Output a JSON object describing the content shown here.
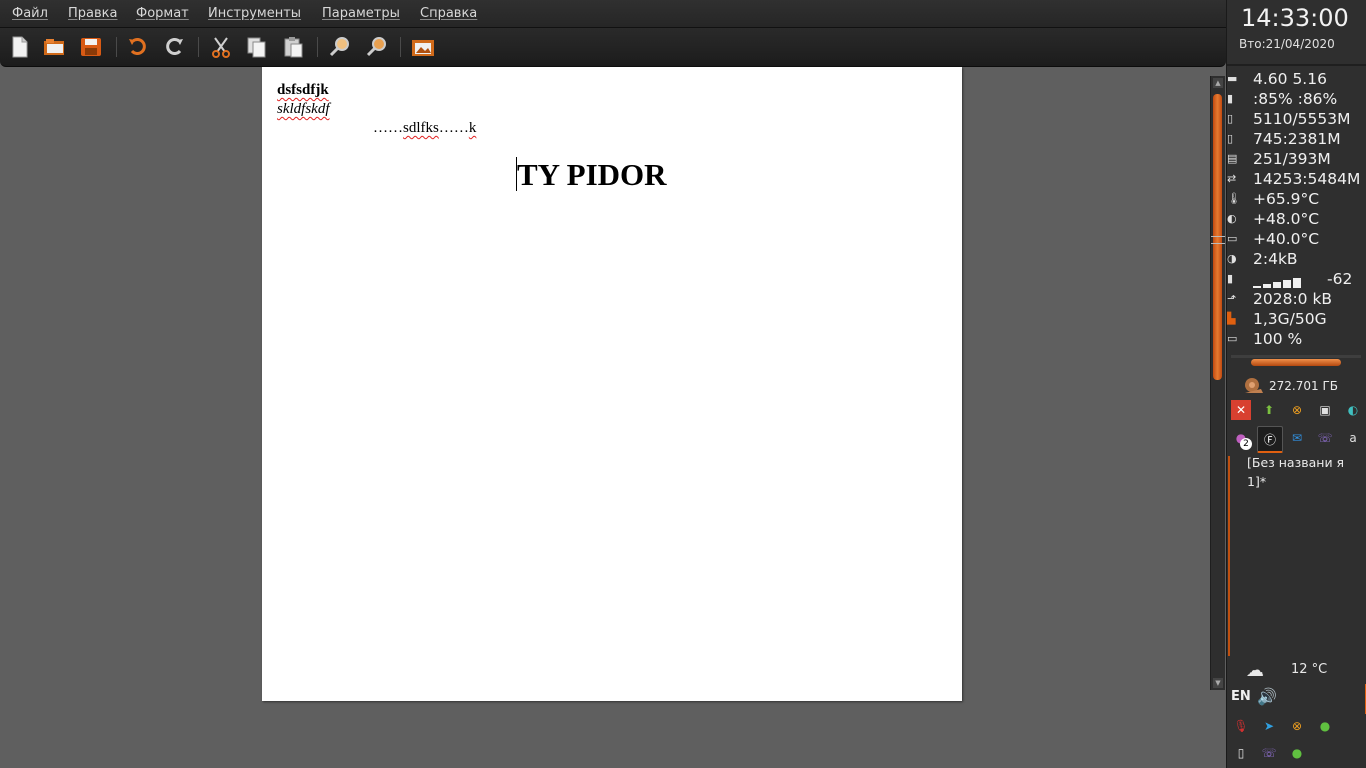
{
  "menu": {
    "items": [
      "Файл",
      "Правка",
      "Формат",
      "Инструменты",
      "Параметры",
      "Справка"
    ]
  },
  "toolbar": {
    "buttons": [
      "new-document-icon",
      "open-folder-icon",
      "save-icon",
      "undo-icon",
      "redo-icon",
      "cut-icon",
      "copy-icon",
      "paste-icon",
      "zoom-in-icon",
      "zoom-out-icon",
      "insert-image-icon"
    ]
  },
  "document": {
    "line1": "dsfsdfjk",
    "line2": "skldfskdf",
    "line3_a": "……",
    "line3_b": "sdlfks",
    "line3_c": "……",
    "line3_d": "k",
    "heading": "TY PIDOR"
  },
  "panel": {
    "clock_time": "14:33:00",
    "clock_date": "Вто:21/04/2020",
    "stats": [
      {
        "icon": "cpu-load-icon",
        "text": "4.60 5.16"
      },
      {
        "icon": "cpu-usage-icon",
        "text": ":85% :86%"
      },
      {
        "icon": "memory-icon",
        "text": "5110/5553M"
      },
      {
        "icon": "swap-icon",
        "text": "745:2381M"
      },
      {
        "icon": "cache-icon",
        "text": "251/393M"
      },
      {
        "icon": "network-icon",
        "text": "14253:5484M"
      },
      {
        "icon": "temperature-icon",
        "text": "+65.9°C"
      },
      {
        "icon": "gpu-temp-icon",
        "text": "+48.0°C"
      },
      {
        "icon": "disk-temp-icon",
        "text": "+40.0°C"
      },
      {
        "icon": "traffic-icon",
        "text": "2:4kB"
      },
      {
        "icon": "wifi-signal-icon",
        "text": "-62"
      },
      {
        "icon": "upload-icon",
        "text": "2028:0 kB"
      },
      {
        "icon": "disk-usage-icon",
        "text": "1,3G/50G"
      },
      {
        "icon": "battery-icon",
        "text": "100 %"
      }
    ],
    "disk_free": "272.701 ГБ",
    "task_label": "[Без названи я 1]*",
    "weather_temp": "12 °C",
    "language": "EN",
    "badge_count": "2"
  },
  "colors": {
    "accent": "#d8601a",
    "background": "#5f5f5f",
    "panel": "#2f2f2f"
  }
}
